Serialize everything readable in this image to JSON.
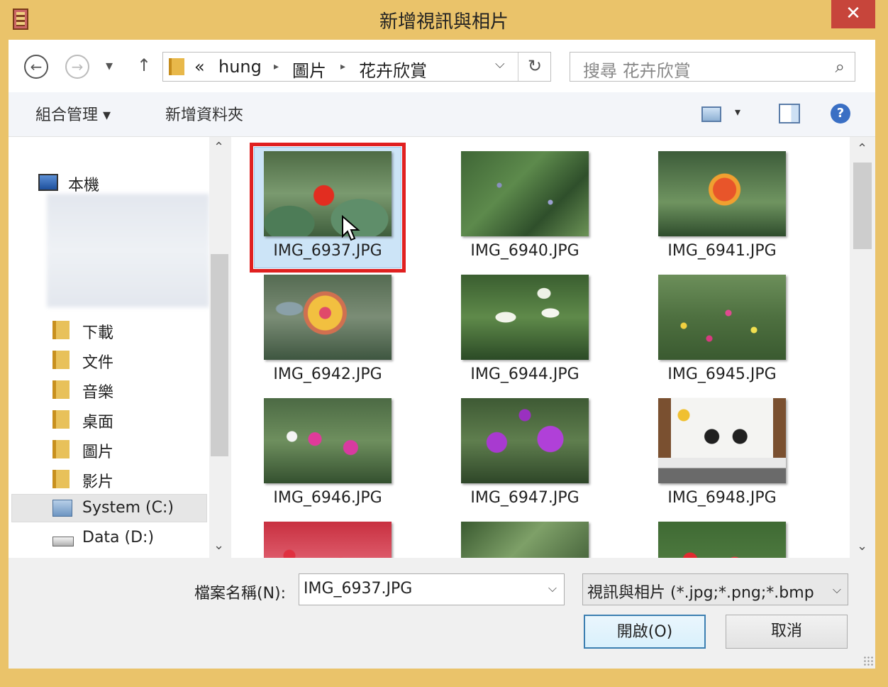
{
  "window": {
    "title": "新增視訊與相片",
    "close_glyph": "✕"
  },
  "nav": {
    "back": "←",
    "forward": "→",
    "recent": "▾",
    "up": "↑"
  },
  "address": {
    "overflow": "«",
    "crumbs": [
      "hung",
      "圖片",
      "花卉欣賞"
    ],
    "separator": "▸",
    "dropdown": "⌵",
    "refresh": "↻"
  },
  "search": {
    "placeholder": "搜尋 花卉欣賞",
    "icon": "⌕"
  },
  "toolbar": {
    "organize": "組合管理 ▾",
    "new_folder": "新增資料夾",
    "view_dropdown": "▾",
    "help": "?"
  },
  "tree": {
    "computer": "本機",
    "items": [
      "下載",
      "文件",
      "音樂",
      "桌面",
      "圖片",
      "影片"
    ],
    "drives": [
      "System (C:)",
      "Data (D:)"
    ],
    "scroll_up": "⌃",
    "scroll_down": "⌄"
  },
  "files": [
    {
      "name": "IMG_6937.JPG",
      "selected": true
    },
    {
      "name": "IMG_6940.JPG"
    },
    {
      "name": "IMG_6941.JPG"
    },
    {
      "name": "IMG_6942.JPG"
    },
    {
      "name": "IMG_6944.JPG"
    },
    {
      "name": "IMG_6945.JPG"
    },
    {
      "name": "IMG_6946.JPG"
    },
    {
      "name": "IMG_6947.JPG"
    },
    {
      "name": "IMG_6948.JPG"
    }
  ],
  "file_scroll": {
    "up": "⌃",
    "down": "⌄"
  },
  "bottom": {
    "filename_label": "檔案名稱(N):",
    "filename_value": "IMG_6937.JPG",
    "filetype_value": "視訊與相片 (*.jpg;*.png;*.bmp",
    "dropdown": "⌵",
    "open_label": "開啟(O)",
    "cancel_label": "取消"
  }
}
